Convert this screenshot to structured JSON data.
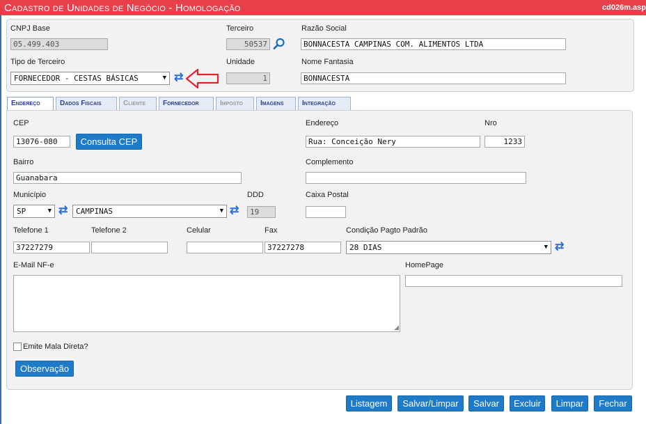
{
  "window": {
    "title": "Cadastro de Unidades de Negócio  - Homologação",
    "filename": "cd026m.asp"
  },
  "header_form": {
    "cnpj_base": {
      "label": "CNPJ Base",
      "value": "05.499.403"
    },
    "terceiro": {
      "label": "Terceiro",
      "value": "50537"
    },
    "razao_social": {
      "label": "Razão Social",
      "value": "BONNACESTA CAMPINAS COM. ALIMENTOS LTDA"
    },
    "tipo_terceiro": {
      "label": "Tipo de Terceiro",
      "value": "FORNECEDOR - CESTAS BÁSICAS"
    },
    "unidade": {
      "label": "Unidade",
      "value": "1"
    },
    "nome_fantasia": {
      "label": "Nome Fantasia",
      "value": "BONNACESTA"
    },
    "annotation_color": "#e8202a"
  },
  "tabs": [
    {
      "label": "Endereço",
      "active": true
    },
    {
      "label": "Dados Fiscais"
    },
    {
      "label": "Cliente",
      "disabled": true
    },
    {
      "label": "Fornecedor"
    },
    {
      "label": "Imposto",
      "disabled": true
    },
    {
      "label": "Imagens"
    },
    {
      "label": "Integração"
    }
  ],
  "endereco": {
    "cep": {
      "label": "CEP",
      "value": "13076-080"
    },
    "consulta_cep_label": "Consulta CEP",
    "endereco": {
      "label": "Endereço",
      "value": "Rua: Conceição Nery"
    },
    "nro": {
      "label": "Nro",
      "value": "1233"
    },
    "bairro": {
      "label": "Bairro",
      "value": "Guanabara"
    },
    "complemento": {
      "label": "Complemento",
      "value": ""
    },
    "municipio": {
      "label": "Município",
      "uf": "SP",
      "cidade": "CAMPINAS"
    },
    "ddd": {
      "label": "DDD",
      "value": "19"
    },
    "caixa_postal": {
      "label": "Caixa Postal",
      "value": ""
    },
    "telefone1": {
      "label": "Telefone 1",
      "value": "37227279"
    },
    "telefone2": {
      "label": "Telefone 2",
      "value": ""
    },
    "celular": {
      "label": "Celular",
      "value": ""
    },
    "fax": {
      "label": "Fax",
      "value": "37227278"
    },
    "condicao_pagto": {
      "label": "Condição Pagto Padrão",
      "value": "28 DIAS"
    },
    "email_nfe": {
      "label": "E-Mail NF-e",
      "value": ""
    },
    "homepage": {
      "label": "HomePage",
      "value": ""
    },
    "mala_direta": {
      "label": "Emite Mala Direta?",
      "checked": false
    },
    "observacao_label": "Observação"
  },
  "actions": [
    "Listagem",
    "Salvar/Limpar",
    "Salvar",
    "Excluir",
    "Limpar",
    "Fechar"
  ],
  "colors": {
    "titlebar": "#e8404a",
    "button": "#1f7ac8",
    "refresh_icon": "#2a6fd6"
  }
}
